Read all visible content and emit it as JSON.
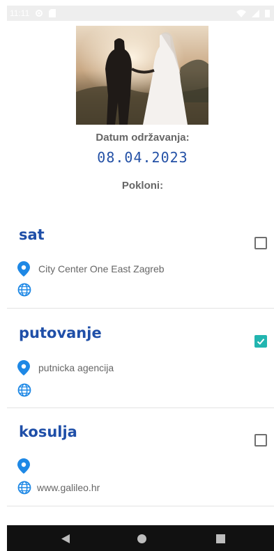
{
  "status_bar": {
    "time": "11:11",
    "icons": [
      "settings-icon",
      "sd-card-icon",
      "wifi-icon",
      "signal-icon",
      "battery-icon"
    ]
  },
  "event": {
    "photo": "wedding-couple-photo",
    "date_label": "Datum održavanja:",
    "date_value": "08.04.2023",
    "gifts_label": "Pokloni:"
  },
  "gifts": [
    {
      "title": "sat",
      "checked": false,
      "location": "City Center One East Zagreb",
      "website": ""
    },
    {
      "title": "putovanje",
      "checked": true,
      "location": "putnicka agencija",
      "website": ""
    },
    {
      "title": "kosulja",
      "checked": false,
      "location": "",
      "website": "www.galileo.hr"
    }
  ],
  "colors": {
    "accent_blue": "#1f4fa8",
    "date_blue": "#2451a6",
    "pin_blue": "#1e88e5",
    "checkbox_teal": "#22b5b0",
    "label_gray": "#666666"
  },
  "nav_bar": {
    "icons": [
      "back-triangle-icon",
      "home-circle-icon",
      "recents-square-icon"
    ]
  }
}
